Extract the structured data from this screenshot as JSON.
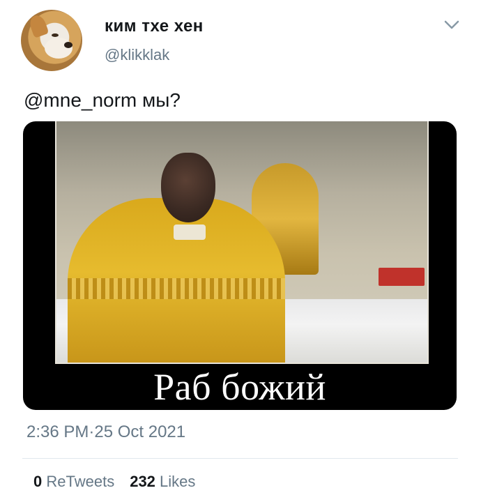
{
  "user": {
    "display_name": "ким тхе хен",
    "handle": "@klikklak",
    "avatar_icon": "dog-avatar"
  },
  "tweet": {
    "text": "@mne_norm мы?",
    "media_caption": "Раб божий",
    "timestamp": "2:36 PM·25 Oct 2021"
  },
  "stats": {
    "retweets_count": "0",
    "retweets_label": "ReTweets",
    "likes_count": "232",
    "likes_label": "Likes"
  },
  "colors": {
    "text_primary": "#14171a",
    "text_secondary": "#657786",
    "divider": "#e1e8ed"
  }
}
